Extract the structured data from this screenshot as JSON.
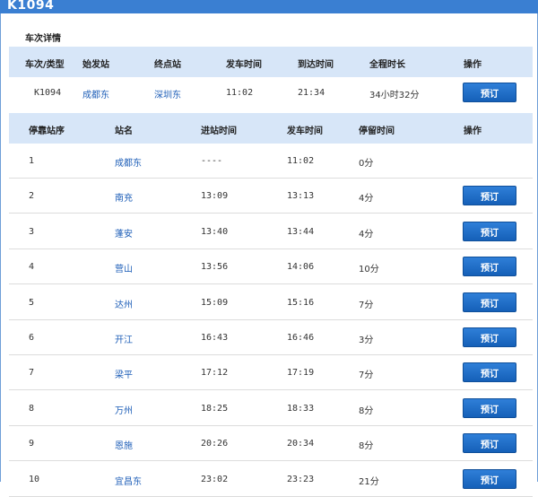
{
  "train": {
    "number": "K1094"
  },
  "details": {
    "section_title": "车次详情",
    "headers": [
      "车次/类型",
      "始发站",
      "终点站",
      "发车时间",
      "到达时间",
      "全程时长",
      "操作"
    ],
    "row": {
      "train_no": "K1094",
      "origin": "成都东",
      "destination": "深圳东",
      "depart": "11:02",
      "arrive": "21:34",
      "duration": "34小时32分",
      "action": "预订"
    }
  },
  "stops": {
    "headers": [
      "停靠站序",
      "站名",
      "进站时间",
      "发车时间",
      "停留时间",
      "操作"
    ],
    "book_label": "预订",
    "rows": [
      {
        "seq": "1",
        "station": "成都东",
        "arrive": "----",
        "depart": "11:02",
        "stay": "0分",
        "bookable": false
      },
      {
        "seq": "2",
        "station": "南充",
        "arrive": "13:09",
        "depart": "13:13",
        "stay": "4分",
        "bookable": true
      },
      {
        "seq": "3",
        "station": "蓬安",
        "arrive": "13:40",
        "depart": "13:44",
        "stay": "4分",
        "bookable": true
      },
      {
        "seq": "4",
        "station": "营山",
        "arrive": "13:56",
        "depart": "14:06",
        "stay": "10分",
        "bookable": true
      },
      {
        "seq": "5",
        "station": "达州",
        "arrive": "15:09",
        "depart": "15:16",
        "stay": "7分",
        "bookable": true
      },
      {
        "seq": "6",
        "station": "开江",
        "arrive": "16:43",
        "depart": "16:46",
        "stay": "3分",
        "bookable": true
      },
      {
        "seq": "7",
        "station": "梁平",
        "arrive": "17:12",
        "depart": "17:19",
        "stay": "7分",
        "bookable": true
      },
      {
        "seq": "8",
        "station": "万州",
        "arrive": "18:25",
        "depart": "18:33",
        "stay": "8分",
        "bookable": true
      },
      {
        "seq": "9",
        "station": "恩施",
        "arrive": "20:26",
        "depart": "20:34",
        "stay": "8分",
        "bookable": true
      },
      {
        "seq": "10",
        "station": "宜昌东",
        "arrive": "23:02",
        "depart": "23:23",
        "stay": "21分",
        "bookable": true
      }
    ]
  }
}
